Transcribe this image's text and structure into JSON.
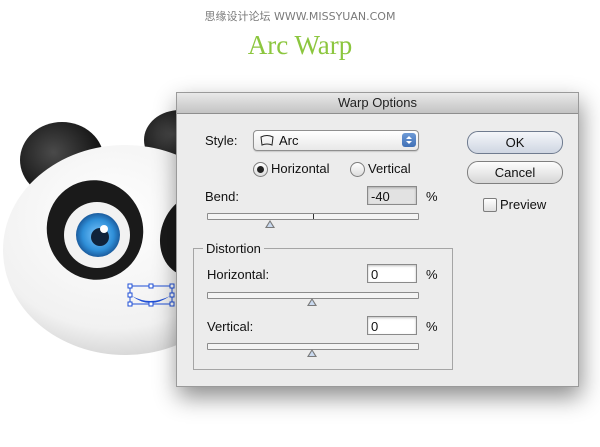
{
  "watermark": "思缘设计论坛 WWW.MISSYUAN.COM",
  "heading": "Arc Warp",
  "dialog": {
    "title": "Warp Options",
    "style_label": "Style:",
    "style_value": "Arc",
    "style_icon": "arc-warp-icon",
    "orientation": {
      "horizontal_label": "Horizontal",
      "vertical_label": "Vertical",
      "selected": "horizontal"
    },
    "bend": {
      "label": "Bend:",
      "value": "-40",
      "unit": "%",
      "slider_percent": -40
    },
    "distortion": {
      "group_label": "Distortion",
      "horizontal": {
        "label": "Horizontal:",
        "value": "0",
        "unit": "%",
        "slider_percent": 0
      },
      "vertical": {
        "label": "Vertical:",
        "value": "0",
        "unit": "%",
        "slider_percent": 0
      }
    },
    "buttons": {
      "ok": "OK",
      "cancel": "Cancel"
    },
    "preview": {
      "label": "Preview",
      "checked": false
    }
  },
  "colors": {
    "heading_green": "#8cc63f",
    "panda_eye_blue": "#2f8fd8",
    "selection_blue": "#1f4fd6"
  }
}
